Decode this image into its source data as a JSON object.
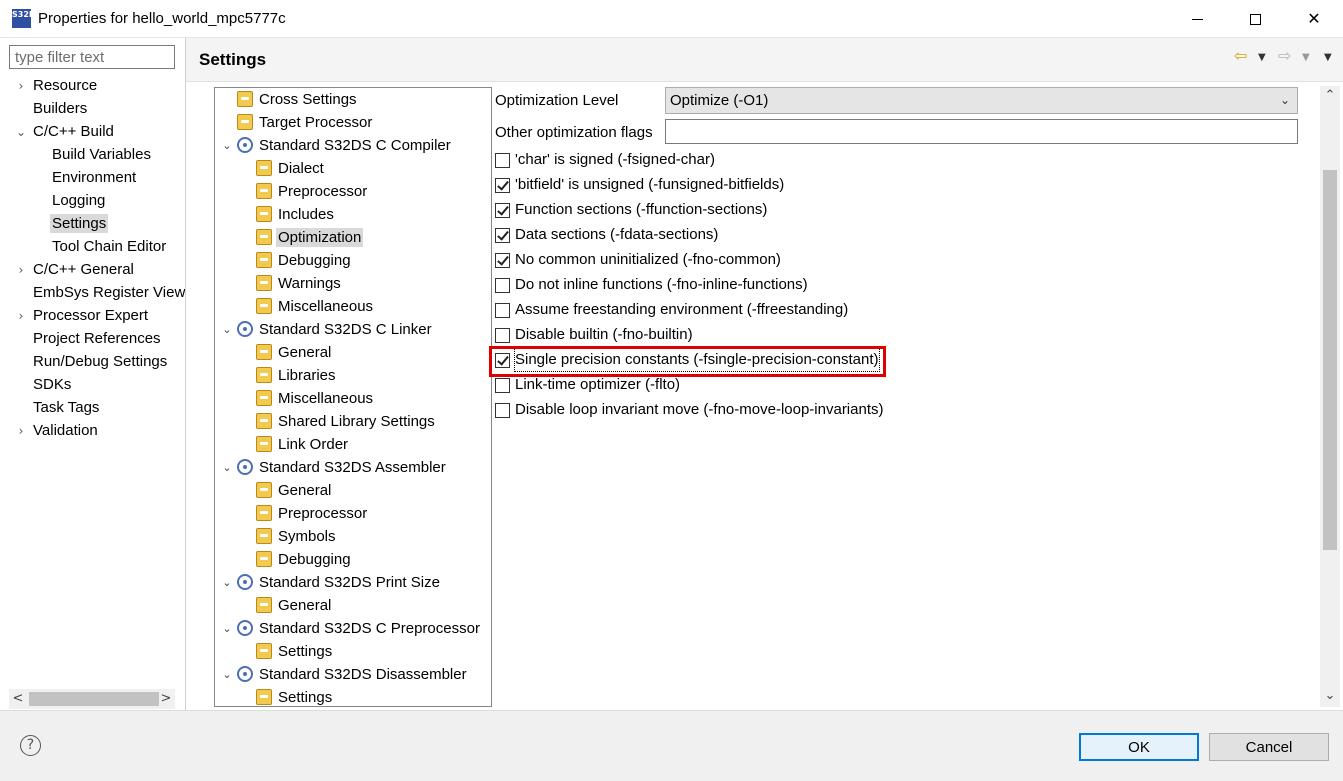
{
  "window": {
    "title": "Properties for hello_world_mpc5777c",
    "app_icon_text": "S32DS",
    "minimize_icon": "minimize-icon",
    "maximize_icon": "maximize-icon",
    "close_icon": "close-icon"
  },
  "filter": {
    "placeholder": "type filter text",
    "value": ""
  },
  "nav": {
    "items": [
      {
        "label": "Resource",
        "expandable": true
      },
      {
        "label": "Builders"
      },
      {
        "label": "C/C++ Build",
        "expanded": true
      },
      {
        "label": "Build Variables"
      },
      {
        "label": "Environment"
      },
      {
        "label": "Logging"
      },
      {
        "label": "Settings",
        "selected": true
      },
      {
        "label": "Tool Chain Editor"
      },
      {
        "label": "C/C++ General",
        "expandable": true
      },
      {
        "label": "EmbSys Register View"
      },
      {
        "label": "Processor Expert",
        "expandable": true
      },
      {
        "label": "Project References"
      },
      {
        "label": "Run/Debug Settings"
      },
      {
        "label": "SDKs"
      },
      {
        "label": "Task Tags"
      },
      {
        "label": "Validation",
        "expandable": true
      }
    ]
  },
  "header": {
    "title": "Settings",
    "back_icon": "back-arrow-icon",
    "forward_icon": "forward-arrow-icon",
    "view_menu_icon": "view-menu-icon"
  },
  "tool_tree": {
    "items": [
      {
        "label": "Cross Settings",
        "icon": "folder-icon"
      },
      {
        "label": "Target Processor",
        "icon": "folder-icon"
      },
      {
        "label": "Standard S32DS C Compiler",
        "icon": "gear-icon",
        "expanded": true
      },
      {
        "label": "Dialect",
        "icon": "folder-icon"
      },
      {
        "label": "Preprocessor",
        "icon": "folder-icon"
      },
      {
        "label": "Includes",
        "icon": "folder-icon"
      },
      {
        "label": "Optimization",
        "icon": "folder-icon",
        "selected": true
      },
      {
        "label": "Debugging",
        "icon": "folder-icon"
      },
      {
        "label": "Warnings",
        "icon": "folder-icon"
      },
      {
        "label": "Miscellaneous",
        "icon": "folder-icon"
      },
      {
        "label": "Standard S32DS C Linker",
        "icon": "gear-icon",
        "expanded": true
      },
      {
        "label": "General",
        "icon": "folder-icon"
      },
      {
        "label": "Libraries",
        "icon": "folder-icon"
      },
      {
        "label": "Miscellaneous",
        "icon": "folder-icon"
      },
      {
        "label": "Shared Library Settings",
        "icon": "folder-icon"
      },
      {
        "label": "Link Order",
        "icon": "folder-icon"
      },
      {
        "label": "Standard S32DS Assembler",
        "icon": "gear-icon",
        "expanded": true
      },
      {
        "label": "General",
        "icon": "folder-icon"
      },
      {
        "label": "Preprocessor",
        "icon": "folder-icon"
      },
      {
        "label": "Symbols",
        "icon": "folder-icon"
      },
      {
        "label": "Debugging",
        "icon": "folder-icon"
      },
      {
        "label": "Standard S32DS Print Size",
        "icon": "gear-icon",
        "expanded": true
      },
      {
        "label": "General",
        "icon": "folder-icon"
      },
      {
        "label": "Standard S32DS C Preprocessor",
        "icon": "gear-icon",
        "expanded": true
      },
      {
        "label": "Settings",
        "icon": "folder-icon"
      },
      {
        "label": "Standard S32DS Disassembler",
        "icon": "gear-icon",
        "expanded": true
      },
      {
        "label": "Settings",
        "icon": "folder-icon"
      }
    ]
  },
  "options": {
    "optimization_level_label": "Optimization Level",
    "optimization_level_value": "Optimize (-O1)",
    "other_flags_label": "Other optimization flags",
    "other_flags_value": "",
    "checkboxes": [
      {
        "label": "'char' is signed (-fsigned-char)",
        "checked": false
      },
      {
        "label": "'bitfield' is unsigned (-funsigned-bitfields)",
        "checked": true
      },
      {
        "label": "Function sections (-ffunction-sections)",
        "checked": true
      },
      {
        "label": "Data sections (-fdata-sections)",
        "checked": true
      },
      {
        "label": "No common uninitialized (-fno-common)",
        "checked": true
      },
      {
        "label": "Do not inline functions (-fno-inline-functions)",
        "checked": false
      },
      {
        "label": "Assume freestanding environment (-ffreestanding)",
        "checked": false
      },
      {
        "label": "Disable builtin (-fno-builtin)",
        "checked": false
      },
      {
        "label": "Single precision constants (-fsingle-precision-constant)",
        "checked": true,
        "highlighted": true
      },
      {
        "label": "Link-time optimizer (-flto)",
        "checked": false
      },
      {
        "label": "Disable loop invariant move (-fno-move-loop-invariants)",
        "checked": false
      }
    ],
    "highlight_color": "#e00000"
  },
  "footer": {
    "help_icon": "help-icon",
    "ok_label": "OK",
    "cancel_label": "Cancel"
  }
}
